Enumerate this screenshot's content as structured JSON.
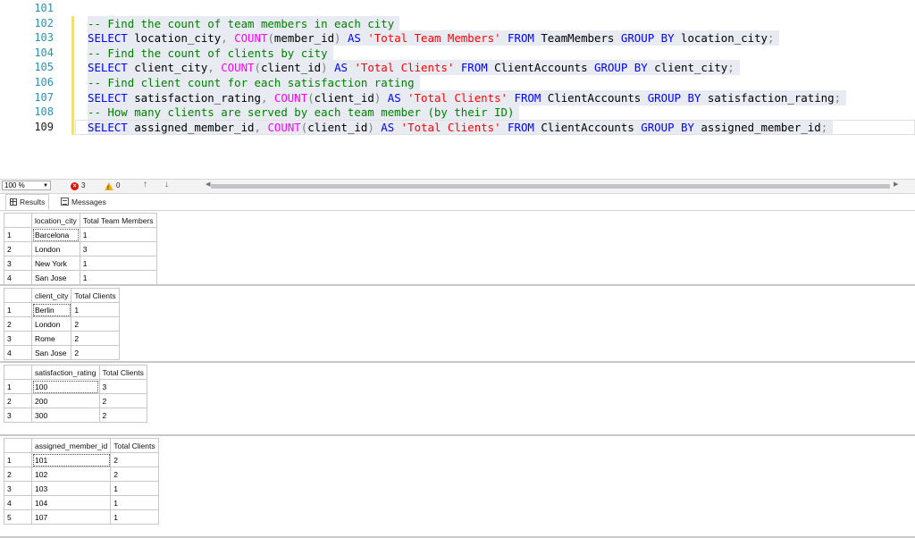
{
  "editor": {
    "lines": [
      {
        "num": "101",
        "tokens": [],
        "hl": false,
        "current": false
      },
      {
        "num": "102",
        "hl": true,
        "current": false,
        "tokens": [
          {
            "c": "cm",
            "t": "-- Find the count of team members in each city"
          }
        ]
      },
      {
        "num": "103",
        "hl": true,
        "current": false,
        "tokens": [
          {
            "c": "kw",
            "t": "SELECT"
          },
          {
            "c": "id",
            "t": " location_city"
          },
          {
            "c": "op",
            "t": ", "
          },
          {
            "c": "fn",
            "t": "COUNT"
          },
          {
            "c": "op",
            "t": "("
          },
          {
            "c": "id",
            "t": "member_id"
          },
          {
            "c": "op",
            "t": ")"
          },
          {
            "c": "kw",
            "t": " AS "
          },
          {
            "c": "st",
            "t": "'Total Team Members'"
          },
          {
            "c": "kw",
            "t": " FROM"
          },
          {
            "c": "id",
            "t": " TeamMembers"
          },
          {
            "c": "kw",
            "t": " GROUP BY"
          },
          {
            "c": "id",
            "t": " location_city"
          },
          {
            "c": "op",
            "t": ";"
          }
        ]
      },
      {
        "num": "104",
        "hl": true,
        "current": false,
        "tokens": [
          {
            "c": "cm",
            "t": "-- Find the count of clients by city"
          }
        ]
      },
      {
        "num": "105",
        "hl": true,
        "current": false,
        "tokens": [
          {
            "c": "kw",
            "t": "SELECT"
          },
          {
            "c": "id",
            "t": " client_city"
          },
          {
            "c": "op",
            "t": ", "
          },
          {
            "c": "fn",
            "t": "COUNT"
          },
          {
            "c": "op",
            "t": "("
          },
          {
            "c": "id",
            "t": "client_id"
          },
          {
            "c": "op",
            "t": ")"
          },
          {
            "c": "kw",
            "t": " AS "
          },
          {
            "c": "st",
            "t": "'Total Clients'"
          },
          {
            "c": "kw",
            "t": " FROM"
          },
          {
            "c": "id",
            "t": " ClientAccounts"
          },
          {
            "c": "kw",
            "t": " GROUP BY"
          },
          {
            "c": "id",
            "t": " client_city"
          },
          {
            "c": "op",
            "t": ";"
          }
        ]
      },
      {
        "num": "106",
        "hl": true,
        "current": false,
        "tokens": [
          {
            "c": "cm",
            "t": "-- Find client count for each satisfaction rating"
          }
        ]
      },
      {
        "num": "107",
        "hl": true,
        "current": false,
        "tokens": [
          {
            "c": "kw",
            "t": "SELECT"
          },
          {
            "c": "id",
            "t": " satisfaction_rating"
          },
          {
            "c": "op",
            "t": ", "
          },
          {
            "c": "fn",
            "t": "COUNT"
          },
          {
            "c": "op",
            "t": "("
          },
          {
            "c": "id",
            "t": "client_id"
          },
          {
            "c": "op",
            "t": ")"
          },
          {
            "c": "kw",
            "t": " AS "
          },
          {
            "c": "st",
            "t": "'Total Clients'"
          },
          {
            "c": "kw",
            "t": " FROM"
          },
          {
            "c": "id",
            "t": " ClientAccounts"
          },
          {
            "c": "kw",
            "t": " GROUP BY"
          },
          {
            "c": "id",
            "t": " satisfaction_rating"
          },
          {
            "c": "op",
            "t": ";"
          }
        ]
      },
      {
        "num": "108",
        "hl": true,
        "current": false,
        "tokens": [
          {
            "c": "cm",
            "t": "-- How many clients are served by each team member (by their ID)"
          }
        ]
      },
      {
        "num": "109",
        "hl": true,
        "current": true,
        "tokens": [
          {
            "c": "kw",
            "t": "SELECT"
          },
          {
            "c": "id",
            "t": " assigned_member_id"
          },
          {
            "c": "op",
            "t": ", "
          },
          {
            "c": "fn",
            "t": "COUNT"
          },
          {
            "c": "op",
            "t": "("
          },
          {
            "c": "id",
            "t": "client_id"
          },
          {
            "c": "op",
            "t": ")"
          },
          {
            "c": "kw",
            "t": " AS "
          },
          {
            "c": "st",
            "t": "'Total Clients'"
          },
          {
            "c": "kw",
            "t": " FROM"
          },
          {
            "c": "id",
            "t": " ClientAccounts"
          },
          {
            "c": "kw",
            "t": " GROUP BY"
          },
          {
            "c": "id",
            "t": " assigned_member_id"
          },
          {
            "c": "op",
            "t": ";"
          }
        ]
      }
    ]
  },
  "status": {
    "zoom": "100 %",
    "errors": "3",
    "warnings": "0"
  },
  "tabs": {
    "results_label": "Results",
    "messages_label": "Messages"
  },
  "results": [
    {
      "columns": [
        "location_city",
        "Total Team Members"
      ],
      "rows": [
        [
          "1",
          "Barcelona",
          "1"
        ],
        [
          "2",
          "London",
          "3"
        ],
        [
          "3",
          "New York",
          "1"
        ],
        [
          "4",
          "San Jose",
          "1"
        ]
      ]
    },
    {
      "columns": [
        "client_city",
        "Total Clients"
      ],
      "rows": [
        [
          "1",
          "Berlin",
          "1"
        ],
        [
          "2",
          "London",
          "2"
        ],
        [
          "3",
          "Rome",
          "2"
        ],
        [
          "4",
          "San Jose",
          "2"
        ]
      ]
    },
    {
      "columns": [
        "satisfaction_rating",
        "Total Clients"
      ],
      "rows": [
        [
          "1",
          "100",
          "3"
        ],
        [
          "2",
          "200",
          "2"
        ],
        [
          "3",
          "300",
          "2"
        ]
      ]
    },
    {
      "columns": [
        "assigned_member_id",
        "Total Clients"
      ],
      "rows": [
        [
          "1",
          "101",
          "2"
        ],
        [
          "2",
          "102",
          "2"
        ],
        [
          "3",
          "103",
          "1"
        ],
        [
          "4",
          "104",
          "1"
        ],
        [
          "5",
          "107",
          "1"
        ]
      ]
    }
  ],
  "colors": {
    "line_number": "#2b91af",
    "keyword": "#0000ff",
    "comment": "#008000",
    "function": "#ff00ff",
    "string": "#ff0000",
    "change_bar": "#efe07a"
  }
}
